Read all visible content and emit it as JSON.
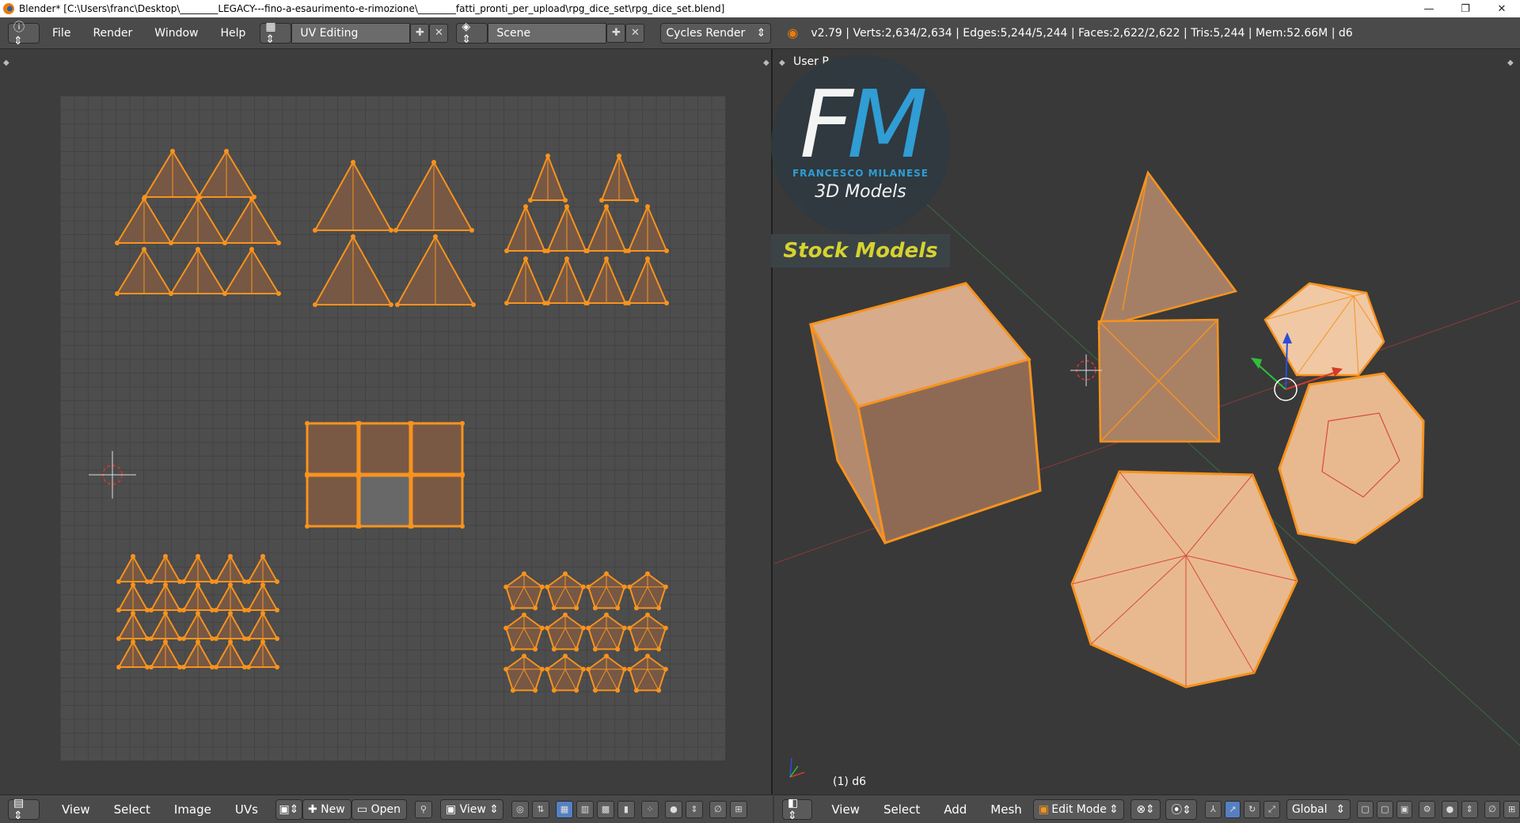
{
  "window": {
    "title": "Blender* [C:\\Users\\franc\\Desktop\\________LEGACY---fino-a-esaurimento-e-rimozione\\________fatti_pronti_per_upload\\rpg_dice_set\\rpg_dice_set.blend]",
    "minimize": "—",
    "maximize": "❐",
    "close": "✕"
  },
  "info_header": {
    "menus": [
      "File",
      "Render",
      "Window",
      "Help"
    ],
    "screen_layout": "UV Editing",
    "scene": "Scene",
    "render_engine": "Cycles Render",
    "stats": "v2.79 | Verts:2,634/2,634 | Edges:5,244/5,244 | Faces:2,622/2,622 | Tris:5,244 | Mem:52.66M | d6"
  },
  "uv_editor": {
    "footer": {
      "menus": [
        "View",
        "Select",
        "Image",
        "UVs"
      ],
      "new_label": "New",
      "open_label": "Open",
      "view_label": "View"
    }
  },
  "viewport": {
    "view_name": "User P",
    "object_label": "(1) d6",
    "footer": {
      "menus": [
        "View",
        "Select",
        "Add",
        "Mesh"
      ],
      "mode": "Edit Mode",
      "orientation": "Global"
    }
  },
  "overlay": {
    "logo_f": "F",
    "logo_m": "M",
    "brand_name": "FRANCESCO MILANESE",
    "brand_tag": "3D Models",
    "stock_label": "Stock Models"
  },
  "colors": {
    "uv_edge": "#f7931e",
    "uv_face": "#7f5b44",
    "mesh_face": "#e8b98f",
    "accent_blue": "#30a3dd",
    "stock_yellow": "#d6d230"
  }
}
